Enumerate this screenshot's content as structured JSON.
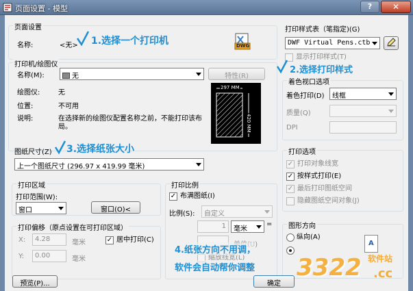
{
  "window": {
    "title": "页面设置 - 模型",
    "help_label": "?",
    "close_label": "✕"
  },
  "page_setup": {
    "caption": "页面设置",
    "name_label": "名称:",
    "name_value": "<无>",
    "dwg_icon_text": "DWG"
  },
  "printer": {
    "caption": "打印机/绘图仪",
    "name_label": "名称(M):",
    "name_value": "无",
    "properties_button": "特性(R)",
    "plotter_label": "绘图仪:",
    "plotter_value": "无",
    "location_label": "位置:",
    "location_value": "不可用",
    "desc_label": "说明:",
    "desc_value_line1": "在选择新的绘图仪配置名称之前，不能打印该布",
    "desc_value_line2": "局。",
    "preview_width": "297 MM",
    "preview_height": "420 MM"
  },
  "paper": {
    "caption": "图纸尺寸(Z)",
    "value": "上一个图纸尺寸  (296.97 x 419.99 毫米)"
  },
  "plot_area": {
    "caption": "打印区域",
    "range_label": "打印范围(W):",
    "range_value": "窗口",
    "window_button": "窗口(O)<"
  },
  "plot_offset": {
    "caption": "打印偏移（原点设置在可打印区域）",
    "x_label": "X:",
    "x_value": "4.28",
    "x_unit": "毫米",
    "y_label": "Y:",
    "y_value": "0.00",
    "y_unit": "毫米",
    "center_label": "居中打印(C)"
  },
  "plot_scale": {
    "caption": "打印比例",
    "fit_label": "布满图纸(I)",
    "scale_label": "比例(S):",
    "scale_value": "自定义",
    "num1": "1",
    "unit_value": "毫米",
    "equals": "=",
    "num2": "",
    "unit2": "单位(U)",
    "lineweight_label": "缩放线宽(L)"
  },
  "plot_style": {
    "caption": "打印样式表（笔指定)(G)",
    "value": "DWF Virtual Pens.ctb",
    "display_label": "显示打印样式(T)"
  },
  "shaded": {
    "caption": "着色视口选项",
    "shade_label": "着色打印(D)",
    "shade_value": "线框",
    "quality_label": "质量(Q)",
    "dpi_label": "DPI"
  },
  "plot_options": {
    "caption": "打印选项",
    "opt1": "打印对象线宽",
    "opt2": "按样式打印(E)",
    "opt3": "最后打印图纸空间",
    "opt4": "隐藏图纸空间对象(J)"
  },
  "orientation": {
    "caption": "图形方向",
    "portrait": "纵向(A)",
    "letter": "A"
  },
  "footer": {
    "preview_button": "预览(P)...",
    "ok_button": "确定"
  },
  "annotations": {
    "a1": "1.选择一个打印机",
    "a2": "2.选择打印样式",
    "a3": "3.选择纸张大小",
    "a4_line1": "4.纸张方向不用调，",
    "a4_line2": "软件会自动帮你调整"
  },
  "watermark": {
    "logo": "3322",
    "sub": "软件站",
    "cc": ".cc"
  },
  "colors": {
    "annotation": "#1e8fd2",
    "watermark": "#f5a623"
  }
}
